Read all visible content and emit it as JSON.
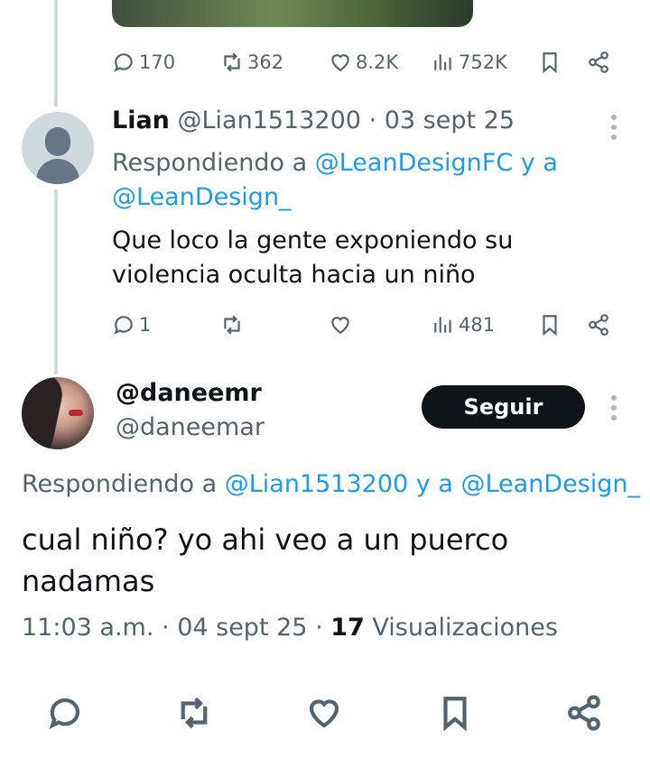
{
  "prev_tweet": {
    "actions": {
      "replies": "170",
      "reposts": "362",
      "likes": "8.2K",
      "views": "752K"
    }
  },
  "reply_tweet": {
    "name": "Lian",
    "handle": "@Lian1513200",
    "date": "03 sept 25",
    "replying_prefix": "Respondiendo a ",
    "mention_1": "@LeanDesignFC",
    "replying_and": " y a",
    "mention_2": "@LeanDesign_",
    "text": "Que loco la gente exponiendo su violencia oculta hacia un niño",
    "actions": {
      "replies": "1",
      "views": "481"
    }
  },
  "focused_tweet": {
    "name": "@daneemr",
    "handle": "@daneemar",
    "follow_label": "Seguir",
    "replying_prefix": "Respondiendo a ",
    "mention_1": "@Lian1513200",
    "replying_and": " y a ",
    "mention_2": "@LeanDesign_",
    "text": "cual niño? yo ahi veo a un puerco nadamas",
    "time": "11:03 a.m.",
    "date": "04 sept 25",
    "views_count": "17",
    "views_label": "Visualizaciones"
  },
  "colors": {
    "accent": "#1d9bf0",
    "text": "#0f1419",
    "muted": "#536471",
    "follow_button": "#0f1419"
  }
}
